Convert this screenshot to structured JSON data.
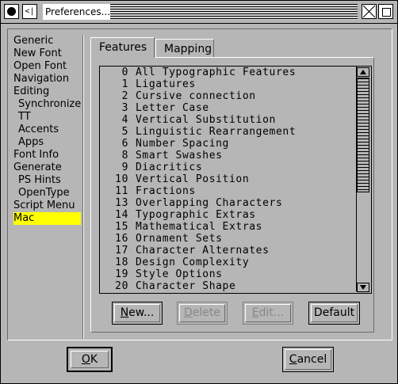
{
  "window": {
    "title": "Preferences...",
    "menu_glyph": "<|"
  },
  "sidebar": {
    "items": [
      {
        "label": "Generic",
        "sub": false
      },
      {
        "label": "New Font",
        "sub": false
      },
      {
        "label": "Open Font",
        "sub": false
      },
      {
        "label": "Navigation",
        "sub": false
      },
      {
        "label": "Editing",
        "sub": false
      },
      {
        "label": "Synchronize",
        "sub": true
      },
      {
        "label": "TT",
        "sub": true
      },
      {
        "label": "Accents",
        "sub": true
      },
      {
        "label": "Apps",
        "sub": true
      },
      {
        "label": "Font Info",
        "sub": false
      },
      {
        "label": "Generate",
        "sub": false
      },
      {
        "label": "PS Hints",
        "sub": true
      },
      {
        "label": "OpenType",
        "sub": true
      },
      {
        "label": "Script Menu",
        "sub": false
      },
      {
        "label": "Mac",
        "sub": false,
        "selected": true
      }
    ],
    "selected_color": "#ffff00"
  },
  "tabs": [
    {
      "label": "Features",
      "active": true
    },
    {
      "label": "Mapping",
      "active": false
    }
  ],
  "feature_list": [
    {
      "num": "0",
      "name": "All Typographic Features"
    },
    {
      "num": "1",
      "name": "Ligatures"
    },
    {
      "num": "2",
      "name": "Cursive connection"
    },
    {
      "num": "3",
      "name": "Letter Case"
    },
    {
      "num": "4",
      "name": "Vertical Substitution"
    },
    {
      "num": "5",
      "name": "Linguistic Rearrangement"
    },
    {
      "num": "6",
      "name": "Number Spacing"
    },
    {
      "num": "8",
      "name": "Smart Swashes"
    },
    {
      "num": "9",
      "name": "Diacritics"
    },
    {
      "num": "10",
      "name": "Vertical Position"
    },
    {
      "num": "11",
      "name": "Fractions"
    },
    {
      "num": "13",
      "name": "Overlapping Characters"
    },
    {
      "num": "14",
      "name": "Typographic Extras"
    },
    {
      "num": "15",
      "name": "Mathematical Extras"
    },
    {
      "num": "16",
      "name": "Ornament Sets"
    },
    {
      "num": "17",
      "name": "Character Alternates"
    },
    {
      "num": "18",
      "name": "Design Complexity"
    },
    {
      "num": "19",
      "name": "Style Options"
    },
    {
      "num": "20",
      "name": "Character Shape"
    }
  ],
  "list_buttons": {
    "new_u": "N",
    "new_rest": "ew...",
    "delete_u": "D",
    "delete_rest": "elete",
    "edit_u": "E",
    "edit_rest": "dit...",
    "default": "Default"
  },
  "dialog_buttons": {
    "ok_u": "O",
    "ok_rest": "K",
    "cancel_u": "C",
    "cancel_rest": "ancel"
  }
}
